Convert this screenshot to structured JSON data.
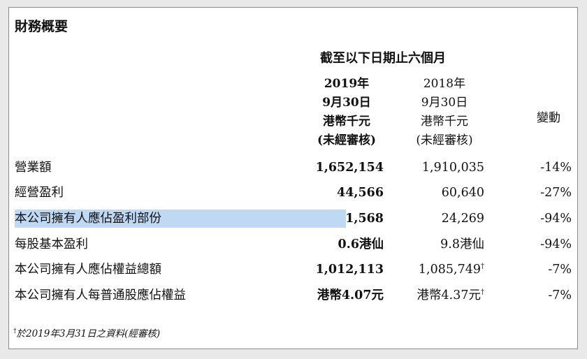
{
  "title": "財務概要",
  "period_header": "截至以下日期止六個月",
  "columns": {
    "y2019": [
      "2019年",
      "9月30日",
      "港幣千元",
      "(未經審核)"
    ],
    "y2018": [
      "2018年",
      "9月30日",
      "港幣千元",
      "(未經審核)"
    ],
    "change": "變動"
  },
  "rows": [
    {
      "label": "營業額",
      "v2019": "1,652,154",
      "v2018": "1,910,035",
      "v2018_mark": "",
      "change": "-14%"
    },
    {
      "label": "經營盈利",
      "v2019": "44,566",
      "v2018": "60,640",
      "v2018_mark": "",
      "change": "-27%"
    },
    {
      "label": "本公司擁有人應佔盈利部份",
      "v2019": "1,568",
      "v2018": "24,269",
      "v2018_mark": "",
      "change": "-94%"
    },
    {
      "label": "每股基本盈利",
      "v2019": "0.6港仙",
      "v2018": "9.8港仙",
      "v2018_mark": "",
      "change": "-94%"
    },
    {
      "label": "本公司擁有人應佔權益總額",
      "v2019": "1,012,113",
      "v2018": "1,085,749",
      "v2018_mark": "†",
      "change": "-7%"
    },
    {
      "label": "本公司擁有人每普通股應佔權益",
      "v2019": "港幣4.07元",
      "v2018": "港幣4.37元",
      "v2018_mark": "†",
      "change": "-7%"
    }
  ],
  "footnote": {
    "mark": "†",
    "text": "於2019年3月31日之資料(經審核)"
  },
  "colors": {
    "selection_highlight": "#bfd8f3"
  }
}
